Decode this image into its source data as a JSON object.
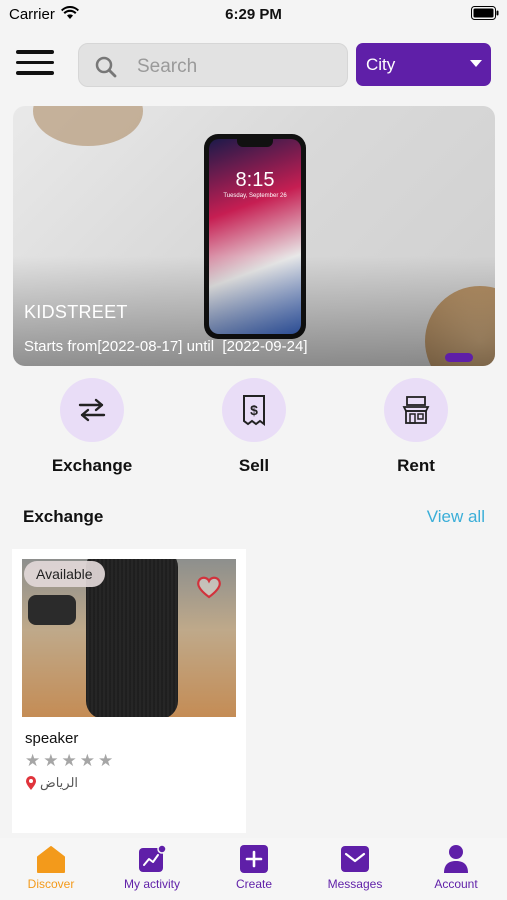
{
  "status_bar": {
    "carrier": "Carrier",
    "time": "6:29 PM"
  },
  "header": {
    "search_placeholder": "Search",
    "city_label": "City"
  },
  "banner": {
    "title": "KIDSTREET",
    "dates_text": "Starts from[2022-08-17] until  [2022-09-24]",
    "phone_clock": "8:15",
    "phone_date": "Tuesday, September 26"
  },
  "categories": [
    {
      "label": "Exchange",
      "icon": "exchange-arrows-icon"
    },
    {
      "label": "Sell",
      "icon": "receipt-dollar-icon"
    },
    {
      "label": "Rent",
      "icon": "rent-shop-icon"
    }
  ],
  "section": {
    "title": "Exchange",
    "view_all": "View all"
  },
  "products": [
    {
      "badge": "Available",
      "name": "speaker",
      "rating": 0,
      "max_rating": 5,
      "location": "الرياض"
    }
  ],
  "bottom_nav": [
    {
      "label": "Discover",
      "icon": "home-icon",
      "active": true
    },
    {
      "label": "My activity",
      "icon": "activity-chart-icon",
      "active": false
    },
    {
      "label": "Create",
      "icon": "plus-icon",
      "active": false
    },
    {
      "label": "Messages",
      "icon": "mail-icon",
      "active": false
    },
    {
      "label": "Account",
      "icon": "person-icon",
      "active": false
    }
  ],
  "colors": {
    "primary": "#5f1fa8",
    "accent_orange": "#f39a1b",
    "link_blue": "#3aaed8",
    "category_circle": "#e9ddf7"
  }
}
